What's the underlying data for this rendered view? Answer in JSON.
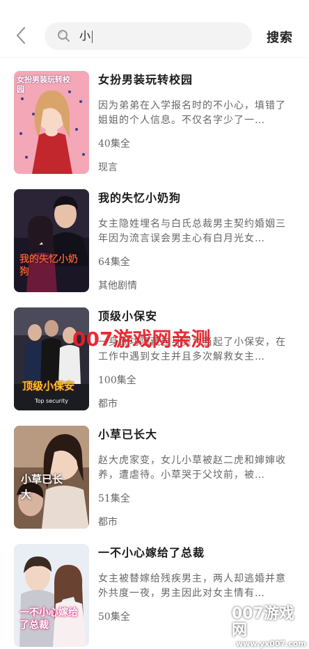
{
  "header": {
    "search_value": "小",
    "search_button": "搜索"
  },
  "results": [
    {
      "title": "女扮男装玩转校园",
      "desc": "因为弟弟在入学报名时的不小心，填错了姐姐的个人信息。不仅名字少了一…",
      "episodes": "40集全",
      "genre": "现言",
      "cover_text": "女扮男装玩转校园"
    },
    {
      "title": "我的失忆小奶狗",
      "desc": "女主隐姓埋名与白氏总裁男主契约婚姻三年因为流言误会男主心有白月光女…",
      "episodes": "64集全",
      "genre": "其他剧情",
      "cover_text": "我的失忆小奶狗"
    },
    {
      "title": "顶级小保安",
      "desc": "一身武功隐藏自身实力当起了小保安，在工作中遇到女主并且多次解救女主…",
      "episodes": "100集全",
      "genre": "都市",
      "cover_text": "顶级小保安",
      "cover_subtext": "Top security"
    },
    {
      "title": "小草已长大",
      "desc": "赵大虎家变，女儿小草被赵二虎和婶婶收养，遭虐待。小草哭于父坟前，被…",
      "episodes": "51集全",
      "genre": "都市",
      "cover_text": "小草已长大"
    },
    {
      "title": "一不小心嫁给了总裁",
      "desc": "女主被替嫁给残疾男主，两人却逃婚并意外共度一夜，男主因此对女主情有…",
      "episodes": "50集全",
      "genre": "",
      "cover_text": "一不小心嫁给了总裁"
    }
  ],
  "watermarks": {
    "center": "007游戏网亲测",
    "corner_big": "007游戏网",
    "corner_small": "www.yx007.com"
  },
  "colors": {
    "accent_red": "#e8202a",
    "background": "#ffffff",
    "search_bg": "#f3f3f3"
  },
  "icons": [
    "back-arrow-icon",
    "search-icon"
  ]
}
